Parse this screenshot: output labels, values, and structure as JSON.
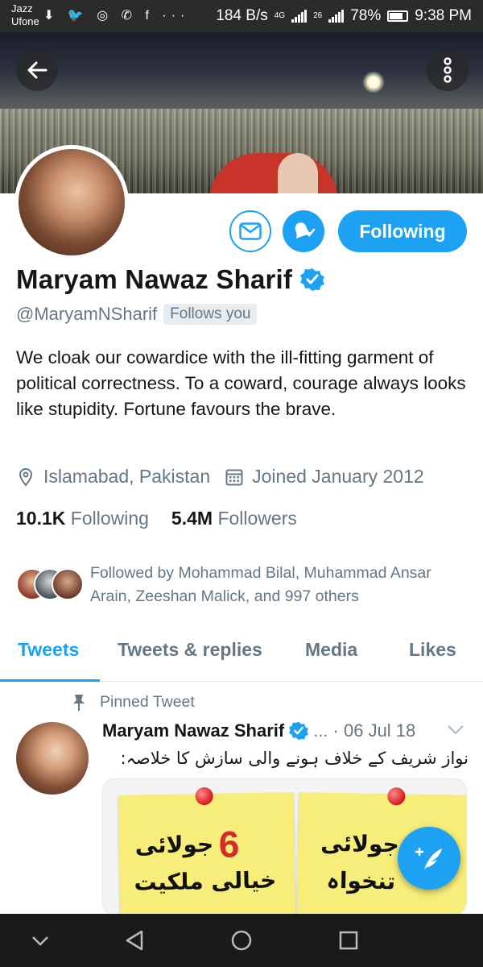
{
  "status_bar": {
    "carrier_line1": "Jazz",
    "carrier_line2": "Ufone",
    "left_icons": "⬇ 🐦 ◎ ✆ f ···",
    "speed": "184 B/s",
    "net1": "4G",
    "net2": "26",
    "battery": "78%",
    "time": "9:38 PM"
  },
  "profile": {
    "name": "Maryam Nawaz Sharif",
    "handle": "@MaryamNSharif",
    "follows_you": "Follows you",
    "bio": "We cloak our cowardice with the ill-fitting garment of political correctness. To a coward, courage always looks like stupidity. Fortune favours the brave.",
    "location": "Islamabad, Pakistan",
    "joined": "Joined January 2012",
    "following_count": "10.1K",
    "following_label": "Following",
    "followers_count": "5.4M",
    "followers_label": "Followers",
    "followed_by": "Followed by Mohammad Bilal, Muhammad Ansar Arain, Zeeshan Malick, and 997 others"
  },
  "actions": {
    "follow_button": "Following"
  },
  "tabs": [
    {
      "label": "Tweets"
    },
    {
      "label": "Tweets & replies"
    },
    {
      "label": "Media"
    },
    {
      "label": "Likes"
    }
  ],
  "pinned_tweet": {
    "pinned_label": "Pinned Tweet",
    "name": "Maryam Nawaz Sharif",
    "handle": "...",
    "date": "· 06 Jul 18",
    "text": "نواز شریف کے خلاف ہونے والی سازش کا خلاصہ:",
    "media": {
      "note1_number": "6",
      "note1_line1": "جولائی",
      "note1_line2": "خیالی ملکیت",
      "note2_line1": "جولائی",
      "note2_line2": "تنخواہ"
    }
  },
  "colors": {
    "accent": "#1da1f2",
    "secondary_text": "#657786",
    "primary_text": "#14171a"
  },
  "icons": [
    "back-arrow-icon",
    "more-vertical-icon",
    "mail-icon",
    "bell-check-icon",
    "verified-badge-icon",
    "location-pin-icon",
    "calendar-icon",
    "pin-icon",
    "chevron-down-icon",
    "compose-tweet-icon",
    "nav-back-icon",
    "nav-home-icon",
    "nav-recents-icon",
    "nav-collapse-icon"
  ]
}
